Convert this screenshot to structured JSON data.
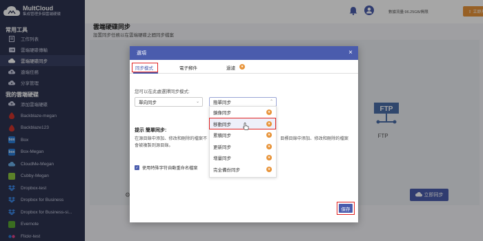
{
  "app": {
    "title": "MultCloud",
    "subtitle": "集成管理多個雲端硬碟"
  },
  "sidebar": {
    "section_tools": "常用工具",
    "tools": [
      {
        "label": "工作列表",
        "icon": "task-list-icon",
        "active": false
      },
      {
        "label": "雲端硬碟傳輸",
        "icon": "cloud-transfer-icon",
        "active": false
      },
      {
        "label": "雲端硬碟同步",
        "icon": "cloud-sync-icon",
        "active": true
      },
      {
        "label": "遠端任務",
        "icon": "remote-upload-icon",
        "active": false
      },
      {
        "label": "分享管理",
        "icon": "share-icon",
        "active": false
      }
    ],
    "section_clouds": "我的雲端硬碟",
    "clouds": [
      {
        "label": "添加雲端硬碟",
        "icon": "add-cloud-icon",
        "color": "#8a90a8"
      },
      {
        "label": "Backblaze-megan",
        "icon": "backblaze-icon",
        "color": "#d0342c"
      },
      {
        "label": "Backblaze123",
        "icon": "backblaze-icon",
        "color": "#d0342c"
      },
      {
        "label": "Box",
        "icon": "box-icon",
        "color": "#2a7dd8"
      },
      {
        "label": "Box-Megan",
        "icon": "box-icon",
        "color": "#2a7dd8"
      },
      {
        "label": "CloudMe-Megan",
        "icon": "cloudme-icon",
        "color": "#6ab0e8"
      },
      {
        "label": "Cubby-Megan",
        "icon": "cubby-icon",
        "color": "#8dc63f"
      },
      {
        "label": "Dropbox-test",
        "icon": "dropbox-icon",
        "color": "#3d8ef0"
      },
      {
        "label": "Dropbox for Business",
        "icon": "dropbox-icon",
        "color": "#3d8ef0"
      },
      {
        "label": "Dropbox for Business-si...",
        "icon": "dropbox-icon",
        "color": "#3d8ef0"
      },
      {
        "label": "Evernote",
        "icon": "evernote-icon",
        "color": "#5aa832"
      },
      {
        "label": "Flickr-test",
        "icon": "flickr-icon",
        "color": "#e0468a"
      }
    ]
  },
  "topbar": {
    "traffic": "數據流量:96.25GB/無限",
    "upgrade": "⇧ 立即升級"
  },
  "main": {
    "title": "雲端硬碟同步",
    "subtitle": "設置同步任務以在雲端硬碟之間同步檔案",
    "ftp_label": "FTP",
    "sync_now": "立即同步"
  },
  "modal": {
    "title": "選項",
    "close": "×",
    "tabs": [
      "同步模式",
      "電子郵件",
      "過濾"
    ],
    "hint": "您可以在此處選擇同步模式:",
    "direction_value": "單向同步",
    "mode_value": "簡單同步",
    "options": [
      "鏡像同步",
      "移動同步",
      "累積同步",
      "更新同步",
      "增量同步",
      "完全備份同步"
    ],
    "desc_title": "提示 簡單同步:",
    "desc_left": "在源目錄中添加、修改和刪除的檔案不會被複製到源目錄。",
    "desc_right": "目標目錄中添加、修改和刪除的檔案",
    "checkbox_label": "使用特殊字符自動重命名檔案",
    "save": "保存"
  }
}
